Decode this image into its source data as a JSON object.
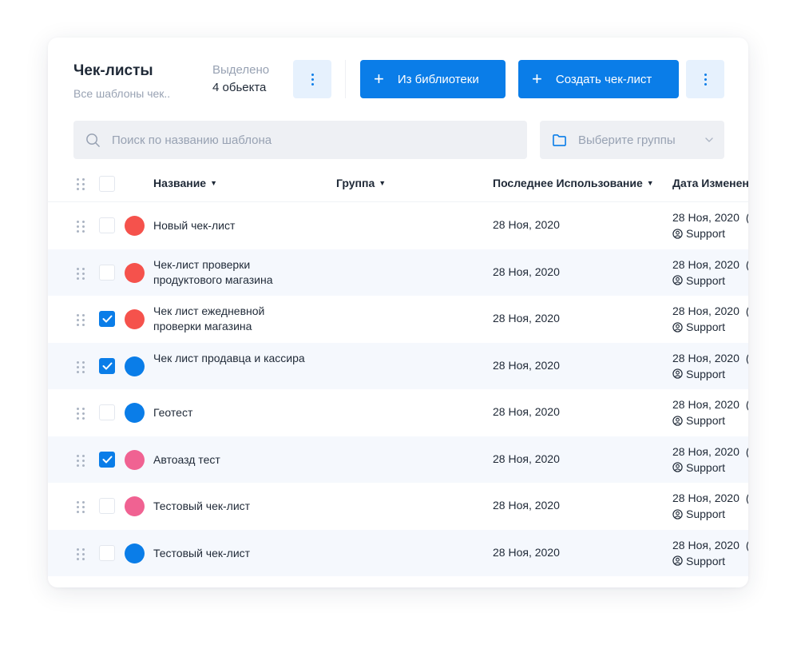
{
  "header": {
    "title": "Чек-листы",
    "subtitle": "Все шаблоны чек..",
    "selection_label": "Выделено",
    "selection_count": "4 обьекта"
  },
  "toolbar": {
    "library_button": "Из библиотеки",
    "create_button": "Создать чек-лист",
    "more_icon": "kebab-vertical-icon"
  },
  "search": {
    "placeholder": "Поиск по названию шаблона",
    "icon": "search-icon"
  },
  "groups_select": {
    "placeholder": "Выберите группы",
    "icon": "folder-icon"
  },
  "table": {
    "columns": {
      "name": "Название",
      "group": "Группа",
      "last_used": "Последнее Использование",
      "modified": "Дата Изменен"
    },
    "rows": [
      {
        "name": "Новый чек-лист",
        "group": "",
        "last_used": "28 Ноя, 2020",
        "modified_date": "28 Ноя, 2020",
        "author": "Support",
        "checked": false,
        "color": "#f5524c"
      },
      {
        "name": "Чек-лист проверки продуктового магазина",
        "group": "",
        "last_used": "28 Ноя, 2020",
        "modified_date": "28 Ноя, 2020",
        "author": "Support",
        "checked": false,
        "color": "#f5524c"
      },
      {
        "name": "Чек лист ежедневной проверки магазина",
        "group": "",
        "last_used": "28 Ноя, 2020",
        "modified_date": "28 Ноя, 2020",
        "author": "Support",
        "checked": true,
        "color": "#f5524c"
      },
      {
        "name": "Чек лист продавца и кассира",
        "group": "",
        "last_used": "28 Ноя, 2020",
        "modified_date": "28 Ноя, 2020",
        "author": "Support",
        "checked": true,
        "color": "#0a7de8"
      },
      {
        "name": "Геотест",
        "group": "",
        "last_used": "28 Ноя, 2020",
        "modified_date": "28 Ноя, 2020",
        "author": "Support",
        "checked": false,
        "color": "#0a7de8"
      },
      {
        "name": "Автоазд тест",
        "group": "",
        "last_used": "28 Ноя, 2020",
        "modified_date": "28 Ноя, 2020",
        "author": "Support",
        "checked": true,
        "color": "#f06292"
      },
      {
        "name": "Тестовый чек-лист",
        "group": "",
        "last_used": "28 Ноя, 2020",
        "modified_date": "28 Ноя, 2020",
        "author": "Support",
        "checked": false,
        "color": "#f06292"
      },
      {
        "name": "Тестовый чек-лист",
        "group": "",
        "last_used": "28 Ноя, 2020",
        "modified_date": "28 Ноя, 2020",
        "author": "Support",
        "checked": false,
        "color": "#0a7de8"
      }
    ]
  },
  "colors": {
    "accent": "#0a7de8",
    "accent_light": "#e6f1fd",
    "row_alt": "#f5f8fd",
    "muted_text": "#98a2b3"
  }
}
